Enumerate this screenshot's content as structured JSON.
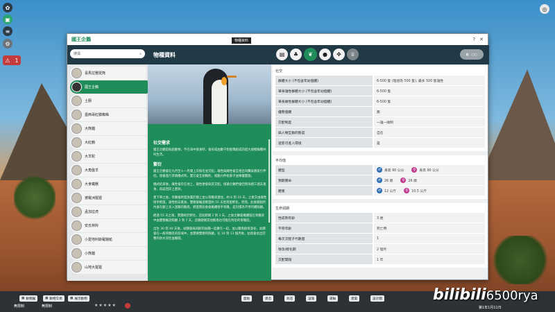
{
  "window": {
    "title": "國王企鵝"
  },
  "search": {
    "placeholder": "搜尋"
  },
  "animals": [
    "喜馬拉雅斑熊",
    "國王企鵝",
    "土豚",
    "墨西哥紅膝蜘蛛",
    "大熊貓",
    "大紅鶴",
    "大羊駝",
    "大角盤羊",
    "大食蟻獸",
    "婆羅洲猩猩",
    "孟加拉虎",
    "安氏林羚",
    "小愛地利斯羅駱鴕",
    "小熊貓",
    "山地大猩猩"
  ],
  "header": {
    "title": "物種資料",
    "tooltip": "物種資料"
  },
  "description": {
    "social_heading": "社交需求",
    "social_text": "國王企鵝是群居動物，不在海中覓食時，會形成由數千對配偶組成的超大規模群體共同生活。",
    "breeding_heading": "繁衍",
    "breeding_text1": "國王企鵝會在九月至十一月間上岸換毛並交配，雄性與雌性會互相出叫聲試著吸引伴侶，接著進行求偶儀式時，雙方會互相鞠躬，搖動力伸長脖子並揮擺雙翅。",
    "breeding_text2": "儀式結束後，雌性會於在地上，雄性便會與其交配。接著企鵝們會回到海裡三週去覓食，再返回岸上產卵。",
    "breeding_text3": "產下單之後，母鵝會將蛋放置於腳上並以育雛袋蓋住，約 6 到 10 天，之後交由雄性接手孵蛋，雄性則去覓食。雙親會輪流孵蛋約 55 天直到蛋孵化，然而，此後兩個月內會在腳上丟入溫暖的雛鳥，孵蛋階段後會繼續接手育雛，差別僅為不用持續照顧。",
    "breeding_text4": "經過 55 天之後，寶寶終於孵化，這段期間 2 到 3 天，之後企鵝會繼續留在育雛袋中由雙親輪流照顧 3 到 7 天。這幾期間其他雛鳥也可能在附近的育雛區。",
    "breeding_text5": "出生 30 到 40 天後，幼鷗會與同齡的幼鷗一起聚在一起，並以雛鳥群育過冬，幼鷗會在一群育雛區的區域中，並需要雙親的照顧。在 10 到 13 個月後，幼鳥會長出完整的防水羽毛並離開。"
  },
  "sections": {
    "social": {
      "title": "社交",
      "rows": [
        {
          "k": "群體大小 (不包含年幼個體)",
          "v": "6-500 隻 (理想為 500 隻), 最多 500 隻雄性"
        },
        {
          "k": "單身雄性群體大小 (不包含年幼個體)",
          "v": "6-500 隻"
        },
        {
          "k": "單身雌性群體大小 (不包含年幼個體)",
          "v": "6-500 隻"
        },
        {
          "k": "優勢個體",
          "v": "無"
        },
        {
          "k": "交配制度",
          "v": "一雄一雌制"
        },
        {
          "k": "與人類互動的態度",
          "v": "自在"
        },
        {
          "k": "遊客可進入環境",
          "v": "是"
        }
      ]
    },
    "average": {
      "title": "平均值",
      "rows": [
        {
          "k": "體型",
          "m": "身高 90 公分",
          "f": "身高 90 公分"
        },
        {
          "k": "預期壽命",
          "m": "26 歲",
          "f": "26 歲"
        },
        {
          "k": "體重",
          "m": "12 公斤",
          "f": "10.5 公斤"
        }
      ]
    },
    "life": {
      "title": "生命週期",
      "rows": [
        {
          "k": "性成熟年齡",
          "v": "3 歲"
        },
        {
          "k": "不育年齡",
          "v": "死亡時"
        },
        {
          "k": "每次交配子代數量",
          "v": "1"
        },
        {
          "k": "懷孕/孵化期",
          "v": "2 個月"
        },
        {
          "k": "交配間隔",
          "v": "1 年"
        }
      ]
    }
  },
  "bottom": {
    "animals_btn": "動物園",
    "info_btn": "動物交易",
    "exhibits_btn": "展示動物",
    "unlimited1": "無限制",
    "unlimited2": "無限制",
    "bar_items": [
      "面板",
      "建造",
      "商店",
      "設施",
      "運輸",
      "建築",
      "設計圖"
    ],
    "date": "第1年1月11日"
  },
  "watermark": {
    "brand": "bilibili",
    "user": "6500rya"
  },
  "colors": {
    "accent": "#1f8d5a",
    "header": "#223a45",
    "male": "#2f6fb3",
    "female": "#c23c8f"
  },
  "icons": [
    "search-icon",
    "gear-icon",
    "help-icon",
    "close-icon",
    "male-icon",
    "female-icon"
  ]
}
